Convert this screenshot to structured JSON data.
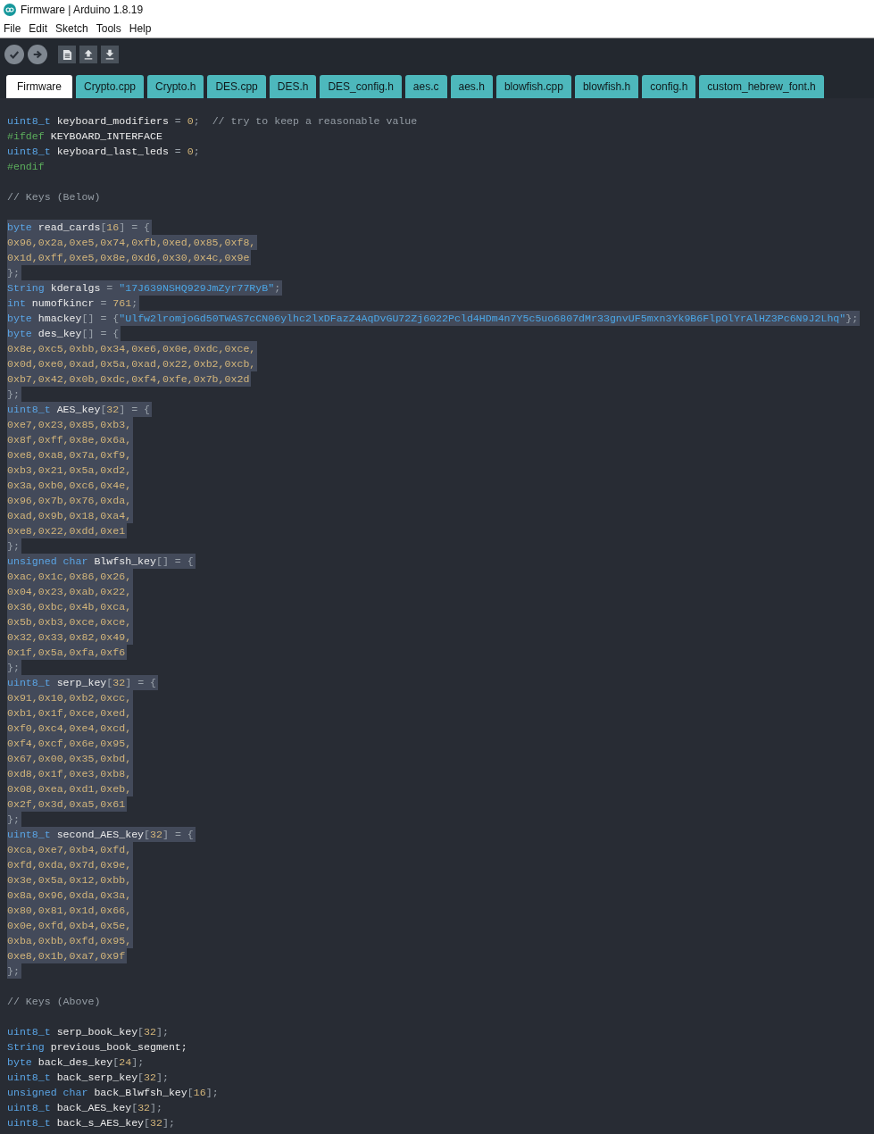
{
  "window": {
    "title": "Firmware | Arduino 1.8.19"
  },
  "menu": [
    "File",
    "Edit",
    "Sketch",
    "Tools",
    "Help"
  ],
  "tabs": [
    {
      "label": "Firmware",
      "selected": true
    },
    {
      "label": "Crypto.cpp",
      "selected": false
    },
    {
      "label": "Crypto.h",
      "selected": false
    },
    {
      "label": "DES.cpp",
      "selected": false
    },
    {
      "label": "DES.h",
      "selected": false
    },
    {
      "label": "DES_config.h",
      "selected": false
    },
    {
      "label": "aes.c",
      "selected": false
    },
    {
      "label": "aes.h",
      "selected": false
    },
    {
      "label": "blowfish.cpp",
      "selected": false
    },
    {
      "label": "blowfish.h",
      "selected": false
    },
    {
      "label": "config.h",
      "selected": false
    },
    {
      "label": "custom_hebrew_font.h",
      "selected": false
    }
  ],
  "code": {
    "lines": [
      {
        "selected": false,
        "segments": [
          {
            "kind": "type",
            "text": "uint8_t"
          },
          {
            "kind": "plain",
            "text": " keyboard_modifiers "
          },
          {
            "kind": "op",
            "text": "= "
          },
          {
            "kind": "number",
            "text": "0"
          },
          {
            "kind": "op",
            "text": ";"
          },
          {
            "kind": "comment",
            "text": "  // try to keep a reasonable value"
          }
        ]
      },
      {
        "selected": false,
        "segments": [
          {
            "kind": "pre",
            "text": "#ifdef"
          },
          {
            "kind": "plain",
            "text": " KEYBOARD_INTERFACE"
          }
        ]
      },
      {
        "selected": false,
        "segments": [
          {
            "kind": "type",
            "text": "uint8_t"
          },
          {
            "kind": "plain",
            "text": " keyboard_last_leds "
          },
          {
            "kind": "op",
            "text": "= "
          },
          {
            "kind": "number",
            "text": "0"
          },
          {
            "kind": "op",
            "text": ";"
          }
        ]
      },
      {
        "selected": false,
        "segments": [
          {
            "kind": "pre",
            "text": "#endif"
          }
        ]
      },
      {
        "selected": false
      },
      {
        "selected": false,
        "segments": [
          {
            "kind": "comment",
            "text": "// Keys (Below)"
          }
        ]
      },
      {
        "selected": false
      },
      {
        "selected": true,
        "segments": [
          {
            "kind": "type",
            "text": "byte"
          },
          {
            "kind": "plain",
            "text": " read_cards"
          },
          {
            "kind": "op",
            "text": "["
          },
          {
            "kind": "number",
            "text": "16"
          },
          {
            "kind": "op",
            "text": "] = {"
          }
        ]
      },
      {
        "selected": true,
        "segments": [
          {
            "kind": "number",
            "text": "0x96,0x2a,0xe5,0x74,0xfb,0xed,0x85,0xf8,"
          }
        ]
      },
      {
        "selected": true,
        "segments": [
          {
            "kind": "number",
            "text": "0x1d,0xff,0xe5,0x8e,0xd6,0x30,0x4c,0x9e"
          }
        ]
      },
      {
        "selected": true,
        "segments": [
          {
            "kind": "op",
            "text": "};"
          }
        ]
      },
      {
        "selected": true,
        "segments": [
          {
            "kind": "type",
            "text": "String"
          },
          {
            "kind": "plain",
            "text": " kderalgs "
          },
          {
            "kind": "op",
            "text": "= "
          },
          {
            "kind": "string",
            "text": "\"17J639NSHQ929JmZyr77RyB\""
          },
          {
            "kind": "op",
            "text": ";"
          }
        ]
      },
      {
        "selected": true,
        "segments": [
          {
            "kind": "type",
            "text": "int"
          },
          {
            "kind": "plain",
            "text": " numofkincr "
          },
          {
            "kind": "op",
            "text": "= "
          },
          {
            "kind": "number",
            "text": "761"
          },
          {
            "kind": "op",
            "text": ";"
          }
        ]
      },
      {
        "selected": true,
        "segments": [
          {
            "kind": "type",
            "text": "byte"
          },
          {
            "kind": "plain",
            "text": " hmackey"
          },
          {
            "kind": "op",
            "text": "[] = {"
          },
          {
            "kind": "string",
            "text": "\"Ulfw2lromjoGd50TWAS7cCN06ylhc2lxDFazZ4AqDvGU72Zj6022Pcld4HDm4n7Y5c5uo6807dMr33gnvUF5mxn3Yk9B6FlpOlYrAlHZ3Pc6N9J2Lhq\""
          },
          {
            "kind": "op",
            "text": "};"
          }
        ]
      },
      {
        "selected": true,
        "segments": [
          {
            "kind": "type",
            "text": "byte"
          },
          {
            "kind": "plain",
            "text": " des_key"
          },
          {
            "kind": "op",
            "text": "[] = {"
          }
        ]
      },
      {
        "selected": true,
        "segments": [
          {
            "kind": "number",
            "text": "0x8e,0xc5,0xbb,0x34,0xe6,0x0e,0xdc,0xce,"
          }
        ]
      },
      {
        "selected": true,
        "segments": [
          {
            "kind": "number",
            "text": "0x0d,0xe0,0xad,0x5a,0xad,0x22,0xb2,0xcb,"
          }
        ]
      },
      {
        "selected": true,
        "segments": [
          {
            "kind": "number",
            "text": "0xb7,0x42,0x0b,0xdc,0xf4,0xfe,0x7b,0x2d"
          }
        ]
      },
      {
        "selected": true,
        "segments": [
          {
            "kind": "op",
            "text": "};"
          }
        ]
      },
      {
        "selected": true,
        "segments": [
          {
            "kind": "type",
            "text": "uint8_t"
          },
          {
            "kind": "plain",
            "text": " AES_key"
          },
          {
            "kind": "op",
            "text": "["
          },
          {
            "kind": "number",
            "text": "32"
          },
          {
            "kind": "op",
            "text": "] = {"
          }
        ]
      },
      {
        "selected": true,
        "segments": [
          {
            "kind": "number",
            "text": "0xe7,0x23,0x85,0xb3,"
          }
        ]
      },
      {
        "selected": true,
        "segments": [
          {
            "kind": "number",
            "text": "0x8f,0xff,0x8e,0x6a,"
          }
        ]
      },
      {
        "selected": true,
        "segments": [
          {
            "kind": "number",
            "text": "0xe8,0xa8,0x7a,0xf9,"
          }
        ]
      },
      {
        "selected": true,
        "segments": [
          {
            "kind": "number",
            "text": "0xb3,0x21,0x5a,0xd2,"
          }
        ]
      },
      {
        "selected": true,
        "segments": [
          {
            "kind": "number",
            "text": "0x3a,0xb0,0xc6,0x4e,"
          }
        ]
      },
      {
        "selected": true,
        "segments": [
          {
            "kind": "number",
            "text": "0x96,0x7b,0x76,0xda,"
          }
        ]
      },
      {
        "selected": true,
        "segments": [
          {
            "kind": "number",
            "text": "0xad,0x9b,0x18,0xa4,"
          }
        ]
      },
      {
        "selected": true,
        "segments": [
          {
            "kind": "number",
            "text": "0xe8,0x22,0xdd,0xe1"
          }
        ]
      },
      {
        "selected": true,
        "segments": [
          {
            "kind": "op",
            "text": "};"
          }
        ]
      },
      {
        "selected": true,
        "segments": [
          {
            "kind": "type",
            "text": "unsigned char"
          },
          {
            "kind": "plain",
            "text": " Blwfsh_key"
          },
          {
            "kind": "op",
            "text": "[] = {"
          }
        ]
      },
      {
        "selected": true,
        "segments": [
          {
            "kind": "number",
            "text": "0xac,0x1c,0x86,0x26,"
          }
        ]
      },
      {
        "selected": true,
        "segments": [
          {
            "kind": "number",
            "text": "0x04,0x23,0xab,0x22,"
          }
        ]
      },
      {
        "selected": true,
        "segments": [
          {
            "kind": "number",
            "text": "0x36,0xbc,0x4b,0xca,"
          }
        ]
      },
      {
        "selected": true,
        "segments": [
          {
            "kind": "number",
            "text": "0x5b,0xb3,0xce,0xce,"
          }
        ]
      },
      {
        "selected": true,
        "segments": [
          {
            "kind": "number",
            "text": "0x32,0x33,0x82,0x49,"
          }
        ]
      },
      {
        "selected": true,
        "segments": [
          {
            "kind": "number",
            "text": "0x1f,0x5a,0xfa,0xf6"
          }
        ]
      },
      {
        "selected": true,
        "segments": [
          {
            "kind": "op",
            "text": "};"
          }
        ]
      },
      {
        "selected": true,
        "segments": [
          {
            "kind": "type",
            "text": "uint8_t"
          },
          {
            "kind": "plain",
            "text": " serp_key"
          },
          {
            "kind": "op",
            "text": "["
          },
          {
            "kind": "number",
            "text": "32"
          },
          {
            "kind": "op",
            "text": "] = {"
          }
        ]
      },
      {
        "selected": true,
        "segments": [
          {
            "kind": "number",
            "text": "0x91,0x10,0xb2,0xcc,"
          }
        ]
      },
      {
        "selected": true,
        "segments": [
          {
            "kind": "number",
            "text": "0xb1,0x1f,0xce,0xed,"
          }
        ]
      },
      {
        "selected": true,
        "segments": [
          {
            "kind": "number",
            "text": "0xf0,0xc4,0xe4,0xcd,"
          }
        ]
      },
      {
        "selected": true,
        "segments": [
          {
            "kind": "number",
            "text": "0xf4,0xcf,0x6e,0x95,"
          }
        ]
      },
      {
        "selected": true,
        "segments": [
          {
            "kind": "number",
            "text": "0x67,0x00,0x35,0xbd,"
          }
        ]
      },
      {
        "selected": true,
        "segments": [
          {
            "kind": "number",
            "text": "0xd8,0x1f,0xe3,0xb8,"
          }
        ]
      },
      {
        "selected": true,
        "segments": [
          {
            "kind": "number",
            "text": "0x08,0xea,0xd1,0xeb,"
          }
        ]
      },
      {
        "selected": true,
        "segments": [
          {
            "kind": "number",
            "text": "0x2f,0x3d,0xa5,0x61"
          }
        ]
      },
      {
        "selected": true,
        "segments": [
          {
            "kind": "op",
            "text": "};"
          }
        ]
      },
      {
        "selected": true,
        "segments": [
          {
            "kind": "type",
            "text": "uint8_t"
          },
          {
            "kind": "plain",
            "text": " second_AES_key"
          },
          {
            "kind": "op",
            "text": "["
          },
          {
            "kind": "number",
            "text": "32"
          },
          {
            "kind": "op",
            "text": "] = {"
          }
        ]
      },
      {
        "selected": true,
        "segments": [
          {
            "kind": "number",
            "text": "0xca,0xe7,0xb4,0xfd,"
          }
        ]
      },
      {
        "selected": true,
        "segments": [
          {
            "kind": "number",
            "text": "0xfd,0xda,0x7d,0x9e,"
          }
        ]
      },
      {
        "selected": true,
        "segments": [
          {
            "kind": "number",
            "text": "0x3e,0x5a,0x12,0xbb,"
          }
        ]
      },
      {
        "selected": true,
        "segments": [
          {
            "kind": "number",
            "text": "0x8a,0x96,0xda,0x3a,"
          }
        ]
      },
      {
        "selected": true,
        "segments": [
          {
            "kind": "number",
            "text": "0x80,0x81,0x1d,0x66,"
          }
        ]
      },
      {
        "selected": true,
        "segments": [
          {
            "kind": "number",
            "text": "0x0e,0xfd,0xb4,0x5e,"
          }
        ]
      },
      {
        "selected": true,
        "segments": [
          {
            "kind": "number",
            "text": "0xba,0xbb,0xfd,0x95,"
          }
        ]
      },
      {
        "selected": true,
        "segments": [
          {
            "kind": "number",
            "text": "0xe8,0x1b,0xa7,0x9f"
          }
        ]
      },
      {
        "selected": true,
        "segments": [
          {
            "kind": "op",
            "text": "};"
          }
        ]
      },
      {
        "selected": false
      },
      {
        "selected": false,
        "segments": [
          {
            "kind": "comment",
            "text": "// Keys (Above)"
          }
        ]
      },
      {
        "selected": false
      },
      {
        "selected": false,
        "segments": [
          {
            "kind": "type",
            "text": "uint8_t"
          },
          {
            "kind": "plain",
            "text": " serp_book_key"
          },
          {
            "kind": "op",
            "text": "["
          },
          {
            "kind": "number",
            "text": "32"
          },
          {
            "kind": "op",
            "text": "];"
          }
        ]
      },
      {
        "selected": false,
        "segments": [
          {
            "kind": "type",
            "text": "String"
          },
          {
            "kind": "plain",
            "text": " previous_book_segment;"
          }
        ]
      },
      {
        "selected": false,
        "segments": [
          {
            "kind": "type",
            "text": "byte"
          },
          {
            "kind": "plain",
            "text": " back_des_key"
          },
          {
            "kind": "op",
            "text": "["
          },
          {
            "kind": "number",
            "text": "24"
          },
          {
            "kind": "op",
            "text": "];"
          }
        ]
      },
      {
        "selected": false,
        "segments": [
          {
            "kind": "type",
            "text": "uint8_t"
          },
          {
            "kind": "plain",
            "text": " back_serp_key"
          },
          {
            "kind": "op",
            "text": "["
          },
          {
            "kind": "number",
            "text": "32"
          },
          {
            "kind": "op",
            "text": "];"
          }
        ]
      },
      {
        "selected": false,
        "segments": [
          {
            "kind": "type",
            "text": "unsigned char"
          },
          {
            "kind": "plain",
            "text": " back_Blwfsh_key"
          },
          {
            "kind": "op",
            "text": "["
          },
          {
            "kind": "number",
            "text": "16"
          },
          {
            "kind": "op",
            "text": "];"
          }
        ]
      },
      {
        "selected": false,
        "segments": [
          {
            "kind": "type",
            "text": "uint8_t"
          },
          {
            "kind": "plain",
            "text": " back_AES_key"
          },
          {
            "kind": "op",
            "text": "["
          },
          {
            "kind": "number",
            "text": "32"
          },
          {
            "kind": "op",
            "text": "];"
          }
        ]
      },
      {
        "selected": false,
        "segments": [
          {
            "kind": "type",
            "text": "uint8_t"
          },
          {
            "kind": "plain",
            "text": " back_s_AES_key"
          },
          {
            "kind": "op",
            "text": "["
          },
          {
            "kind": "number",
            "text": "32"
          },
          {
            "kind": "op",
            "text": "];"
          }
        ]
      }
    ]
  }
}
